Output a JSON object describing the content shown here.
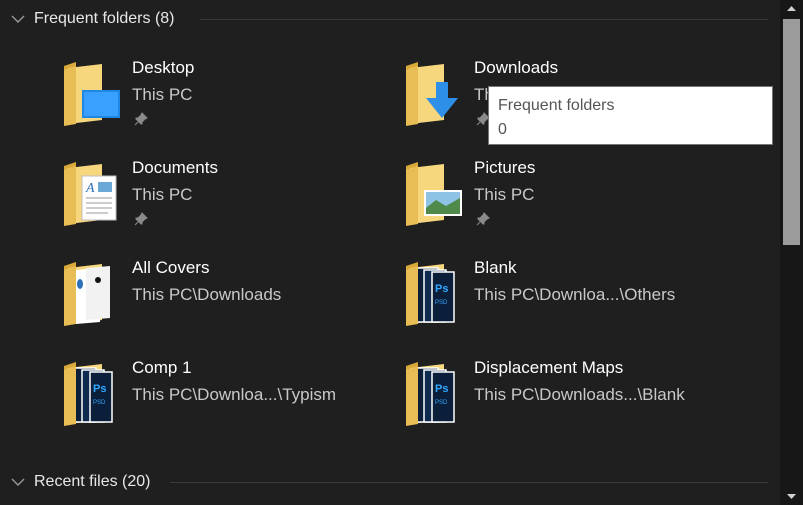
{
  "frequent": {
    "header": "Frequent folders (8)",
    "items": [
      {
        "name": "Desktop",
        "path": "This PC",
        "pinned": true,
        "icon": "desktop-folder-icon"
      },
      {
        "name": "Downloads",
        "path": "This PC",
        "pinned": true,
        "icon": "downloads-folder-icon"
      },
      {
        "name": "Documents",
        "path": "This PC",
        "pinned": true,
        "icon": "documents-folder-icon"
      },
      {
        "name": "Pictures",
        "path": "This PC",
        "pinned": true,
        "icon": "pictures-folder-icon"
      },
      {
        "name": "All Covers",
        "path": "This PC\\Downloads",
        "pinned": false,
        "icon": "folder-icon"
      },
      {
        "name": "Blank",
        "path": "This PC\\Downloa...\\Others",
        "pinned": false,
        "icon": "psd-folder-icon"
      },
      {
        "name": "Comp 1",
        "path": "This PC\\Downloa...\\Typism",
        "pinned": false,
        "icon": "psd-folder-icon"
      },
      {
        "name": "Displacement Maps",
        "path": "This PC\\Downloads...\\Blank",
        "pinned": false,
        "icon": "psd-folder-icon"
      }
    ]
  },
  "recent": {
    "header": "Recent files (20)"
  },
  "tooltip": {
    "line1": "Frequent folders",
    "line2": "0"
  },
  "colors": {
    "background": "#1f1f1f",
    "folder": "#f4d37a",
    "accent": "#2d8fe8"
  }
}
